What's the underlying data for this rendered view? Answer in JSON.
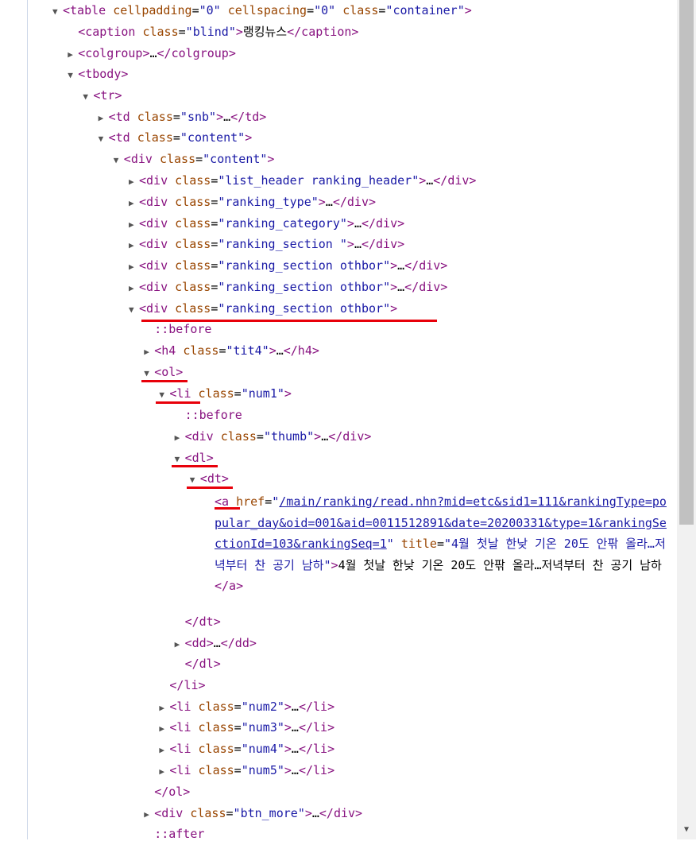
{
  "lines": [
    {
      "toggle": "▼",
      "open": "<table",
      "attrs": [
        {
          "n": "cellpadding",
          "v": "0"
        },
        {
          "n": "cellspacing",
          "v": "0"
        },
        {
          "n": "class",
          "v": "container"
        }
      ],
      "close": ">"
    },
    {
      "toggle": "",
      "open": "<caption",
      "attrs": [
        {
          "n": "class",
          "v": "blind"
        }
      ],
      "close": ">",
      "text": "랭킹뉴스",
      "end": "</caption>"
    },
    {
      "toggle": "▶",
      "open": "<colgroup",
      "attrs": [],
      "close": ">",
      "text": "…",
      "end": "</colgroup>"
    },
    {
      "toggle": "▼",
      "open": "<tbody",
      "attrs": [],
      "close": ">"
    },
    {
      "toggle": "▼",
      "open": "<tr",
      "attrs": [],
      "close": ">"
    },
    {
      "toggle": "▶",
      "open": "<td",
      "attrs": [
        {
          "n": "class",
          "v": "snb"
        }
      ],
      "close": ">",
      "text": "…",
      "end": "</td>"
    },
    {
      "toggle": "▼",
      "open": "<td",
      "attrs": [
        {
          "n": "class",
          "v": "content"
        }
      ],
      "close": ">"
    },
    {
      "toggle": "▼",
      "open": "<div",
      "attrs": [
        {
          "n": "class",
          "v": "content"
        }
      ],
      "close": ">"
    },
    {
      "toggle": "▶",
      "open": "<div",
      "attrs": [
        {
          "n": "class",
          "v": "list_header ranking_header"
        }
      ],
      "close": ">",
      "text": "…",
      "end": "</div>"
    },
    {
      "toggle": "▶",
      "open": "<div",
      "attrs": [
        {
          "n": "class",
          "v": "ranking_type"
        }
      ],
      "close": ">",
      "text": "…",
      "end": "</div>"
    },
    {
      "toggle": "▶",
      "open": "<div",
      "attrs": [
        {
          "n": "class",
          "v": "ranking_category"
        }
      ],
      "close": ">",
      "text": "…",
      "end": "</div>"
    },
    {
      "toggle": "▶",
      "open": "<div",
      "attrs": [
        {
          "n": "class",
          "v": "ranking_section "
        }
      ],
      "close": ">",
      "text": "…",
      "end": "</div>"
    },
    {
      "toggle": "▶",
      "open": "<div",
      "attrs": [
        {
          "n": "class",
          "v": "ranking_section othbor"
        }
      ],
      "close": ">",
      "text": "…",
      "end": "</div>"
    },
    {
      "toggle": "▶",
      "open": "<div",
      "attrs": [
        {
          "n": "class",
          "v": "ranking_section othbor"
        }
      ],
      "close": ">",
      "text": "…",
      "end": "</div>"
    },
    {
      "toggle": "▼",
      "open": "<div",
      "attrs": [
        {
          "n": "class",
          "v": "ranking_section othbor"
        }
      ],
      "close": ">"
    },
    {
      "toggle": "",
      "pseudo": "::before"
    },
    {
      "toggle": "▶",
      "open": "<h4",
      "attrs": [
        {
          "n": "class",
          "v": "tit4"
        }
      ],
      "close": ">",
      "text": "…",
      "end": "</h4>"
    },
    {
      "toggle": "▼",
      "open": "<ol",
      "attrs": [],
      "close": ">"
    },
    {
      "toggle": "▼",
      "open": "<li",
      "attrs": [
        {
          "n": "class",
          "v": "num1"
        }
      ],
      "close": ">"
    },
    {
      "toggle": "",
      "pseudo": "::before"
    },
    {
      "toggle": "▶",
      "open": "<div",
      "attrs": [
        {
          "n": "class",
          "v": "thumb"
        }
      ],
      "close": ">",
      "text": "…",
      "end": "</div>"
    },
    {
      "toggle": "▼",
      "open": "<dl",
      "attrs": [],
      "close": ">"
    },
    {
      "toggle": "▼",
      "open": "<dt",
      "attrs": [],
      "close": ">"
    },
    {
      "toggle": "",
      "end": "</dt>"
    },
    {
      "toggle": "▶",
      "open": "<dd",
      "attrs": [],
      "close": ">",
      "text": "…",
      "end": "</dd>"
    },
    {
      "toggle": "",
      "end": "</dl>"
    },
    {
      "toggle": "",
      "end": "</li>"
    },
    {
      "toggle": "▶",
      "open": "<li",
      "attrs": [
        {
          "n": "class",
          "v": "num2"
        }
      ],
      "close": ">",
      "text": "…",
      "end": "</li>"
    },
    {
      "toggle": "▶",
      "open": "<li",
      "attrs": [
        {
          "n": "class",
          "v": "num3"
        }
      ],
      "close": ">",
      "text": "…",
      "end": "</li>"
    },
    {
      "toggle": "▶",
      "open": "<li",
      "attrs": [
        {
          "n": "class",
          "v": "num4"
        }
      ],
      "close": ">",
      "text": "…",
      "end": "</li>"
    },
    {
      "toggle": "▶",
      "open": "<li",
      "attrs": [
        {
          "n": "class",
          "v": "num5"
        }
      ],
      "close": ">",
      "text": "…",
      "end": "</li>"
    },
    {
      "toggle": "",
      "end": "</ol>"
    },
    {
      "toggle": "▶",
      "open": "<div",
      "attrs": [
        {
          "n": "class",
          "v": "btn_more"
        }
      ],
      "close": ">",
      "text": "…",
      "end": "</div>"
    },
    {
      "toggle": "",
      "pseudo": "::after"
    }
  ],
  "anchor": {
    "open": "<a",
    "href_name": "href",
    "href": "/main/ranking/read.nhn?mid=etc&sid1=111&rankingType=popular_day&oid=001&aid=0011512891&date=20200331&type=1&rankingSectionId=103&rankingSeq=1",
    "title_name": "title",
    "title": "4월 첫날 한낮 기온 20도 안팎 올라…저녁부터 찬 공기 남하",
    "text": "4월 첫날 한낮 기온 20도 안팎 올라…저녁부터 찬 공기 남하",
    "end": "</a>"
  },
  "colors": {
    "tag": "#881280",
    "attr": "#994500",
    "value": "#1a1aa6",
    "highlight": "#e8000a"
  }
}
